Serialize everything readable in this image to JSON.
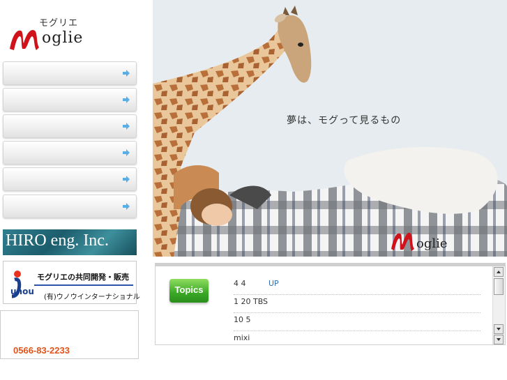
{
  "logo": {
    "kana": "モグリエ",
    "word": "oglie"
  },
  "nav": {
    "items": [
      {
        "label": ""
      },
      {
        "label": ""
      },
      {
        "label": ""
      },
      {
        "label": ""
      },
      {
        "label": ""
      },
      {
        "label": ""
      }
    ]
  },
  "banners": {
    "hiro": "HIRO eng. Inc.",
    "unou": {
      "line1": "モグリエの共同開発・販売",
      "line2": "(有)ウノウインターナショナル",
      "logo_word": "unou"
    }
  },
  "contact": {
    "tel": "0566-83-2233"
  },
  "hero": {
    "tagline": "夢は、モグって見るもの",
    "logo_word": "oglie"
  },
  "topics": {
    "badge": "Topics",
    "items": [
      {
        "text": "4 4",
        "link": "UP"
      },
      {
        "text": "1 20  TBS",
        "link": ""
      },
      {
        "text": "10 5",
        "link": ""
      },
      {
        "text": "mixi",
        "link": ""
      }
    ]
  },
  "colors": {
    "accent_red": "#d0121b",
    "tel_orange": "#e0531a",
    "topics_green": "#3aa826",
    "link_blue": "#2a6fb5"
  }
}
